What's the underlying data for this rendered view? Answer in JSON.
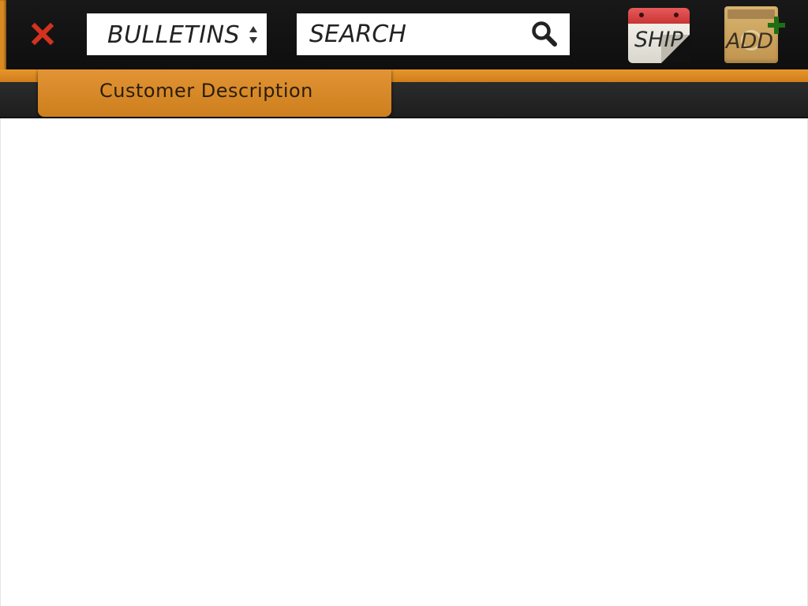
{
  "toolbar": {
    "close_icon": "close-x-icon",
    "category_select": {
      "value": "BULLETINS",
      "icon": "sort-arrows-icon"
    },
    "search": {
      "placeholder": "SEARCH",
      "value": "",
      "icon": "magnifier-icon"
    },
    "ship_button": {
      "label": "SHIP",
      "icon": "calendar-icon"
    },
    "add_button": {
      "label": "ADD",
      "icon": "notebook-plus-icon"
    }
  },
  "tabs": [
    {
      "label": "Customer Description",
      "active": true
    }
  ],
  "colors": {
    "accent_orange": "#d98a22",
    "close_red": "#d4321f",
    "add_plus_green": "#2e8b1e",
    "toolbar_bg": "#141414"
  }
}
